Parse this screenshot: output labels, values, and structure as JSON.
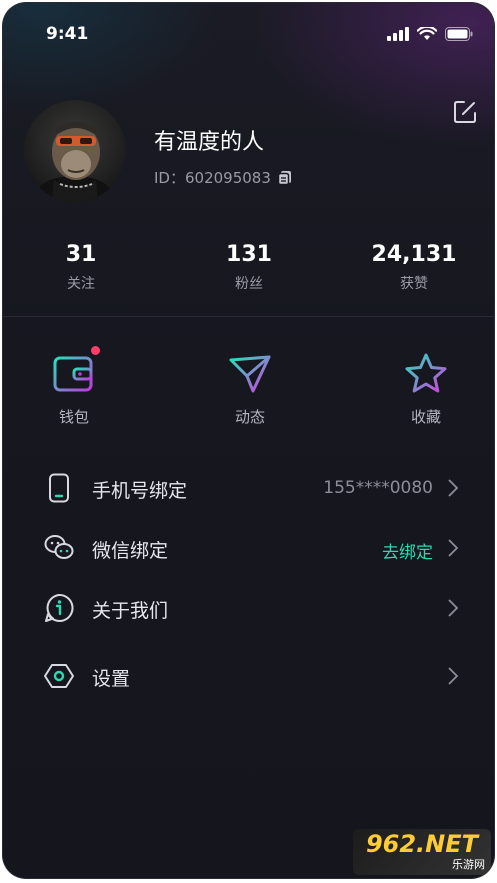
{
  "status_bar": {
    "time": "9:41"
  },
  "profile": {
    "username": "有温度的人",
    "id_label": "ID：",
    "id_value": "602095083"
  },
  "stats": [
    {
      "count": "31",
      "label": "关注"
    },
    {
      "count": "131",
      "label": "粉丝"
    },
    {
      "count": "24,131",
      "label": "获赞"
    }
  ],
  "quick_actions": [
    {
      "label": "钱包",
      "icon": "wallet-icon",
      "has_badge": true
    },
    {
      "label": "动态",
      "icon": "paper-plane-icon"
    },
    {
      "label": "收藏",
      "icon": "star-icon"
    }
  ],
  "menu": [
    {
      "label": "手机号绑定",
      "value": "155****0080",
      "icon": "phone-icon"
    },
    {
      "label": "微信绑定",
      "value": "去绑定",
      "icon": "wechat-icon"
    },
    {
      "label": "关于我们",
      "value": "",
      "icon": "info-icon"
    },
    {
      "label": "设置",
      "value": "",
      "icon": "settings-icon"
    }
  ],
  "colors": {
    "accent_green": "#2fd8b1",
    "badge_red": "#ff3d6b",
    "background": "#16171f"
  },
  "watermark": {
    "main": "962.NET",
    "sub": "乐游网"
  }
}
